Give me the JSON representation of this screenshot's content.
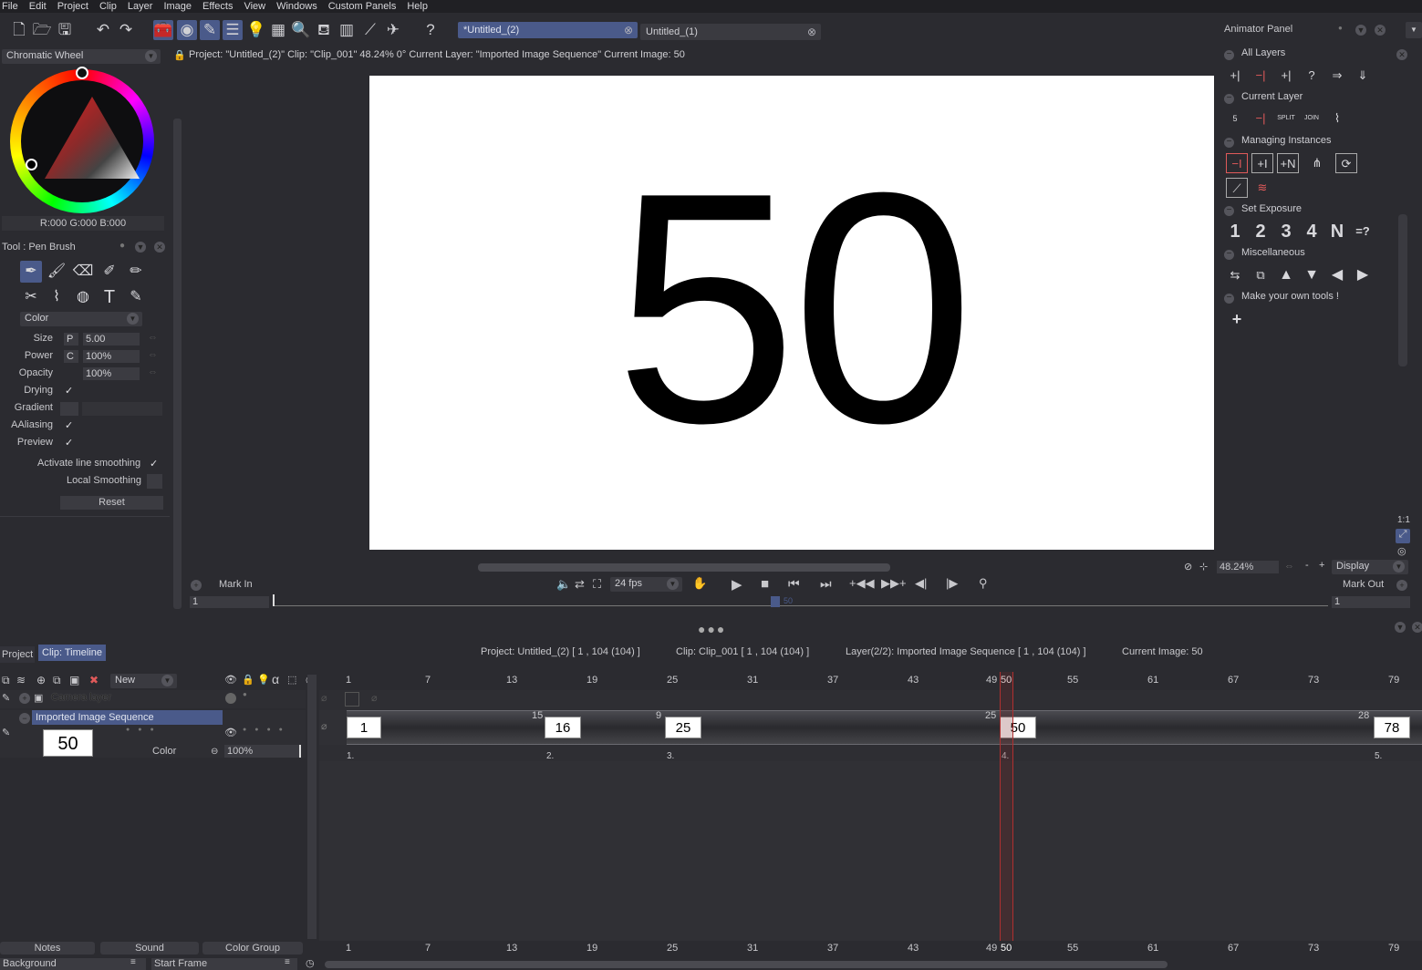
{
  "menu": [
    "File",
    "Edit",
    "Project",
    "Clip",
    "Layer",
    "Image",
    "Effects",
    "View",
    "Windows",
    "Custom Panels",
    "Help"
  ],
  "tabs": [
    {
      "label": "*Untitled_(2)",
      "active": true
    },
    {
      "label": "Untitled_(1)",
      "active": false
    }
  ],
  "info_bar": "Project:  \"Untitled_(2)\"  Clip: \"Clip_001\"   48.24%   0°  Current Layer: \"Imported Image Sequence\"  Current Image: 50",
  "color_panel": {
    "mode": "Chromatic Wheel",
    "rgb": "R:000 G:000 B:000"
  },
  "tool_panel": {
    "title": "Tool : Pen Brush",
    "color_mode": "Color",
    "size_label": "Size",
    "size_mode": "P",
    "size_value": "5.00",
    "power_label": "Power",
    "power_mode": "C",
    "power_value": "100%",
    "opacity_label": "Opacity",
    "opacity_value": "100%",
    "drying_label": "Drying",
    "gradient_label": "Gradient",
    "aaliasing_label": "AAliasing",
    "preview_label": "Preview",
    "line_smoothing_label": "Activate line smoothing",
    "local_smoothing_label": "Local Smoothing",
    "reset_label": "Reset"
  },
  "viewer": {
    "frame_number": "50",
    "zoom": "48.24%",
    "display": "Display",
    "fps": "24 fps",
    "mark_in_label": "Mark In",
    "mark_out_label": "Mark Out",
    "mark_in_value": "1",
    "mark_out_value": "1",
    "scrub_value": "50"
  },
  "animator": {
    "title": "Animator Panel",
    "sections": {
      "all_layers": "All Layers",
      "current_layer": "Current Layer",
      "managing_instances": "Managing Instances",
      "set_exposure": "Set Exposure",
      "misc": "Miscellaneous",
      "make_own": "Make your own tools !"
    },
    "exposure_buttons": [
      "1",
      "2",
      "3",
      "4",
      "N",
      "=?"
    ],
    "cl_labels": [
      "5",
      "",
      "SPLIT",
      "JOIN",
      ""
    ]
  },
  "timeline": {
    "tabs": [
      "Project",
      "Clip: Timeline"
    ],
    "project_info": "Project: Untitled_(2) [ 1 , 104  (104) ]",
    "clip_info": "Clip: Clip_001 [ 1 , 104  (104) ]",
    "layer_info": "Layer(2/2): Imported Image Sequence [ 1 , 104  (104) ]",
    "current_image": "Current Image: 50",
    "new_label": "New",
    "camera_layer": "Camera layer",
    "layer_name": "Imported Image Sequence",
    "layer_thumb": "50",
    "layer_mode": "Color",
    "layer_opacity": "100%",
    "ruler": [
      "1",
      "7",
      "13",
      "19",
      "25",
      "31",
      "37",
      "43",
      "49",
      "50",
      "55",
      "61",
      "67",
      "73",
      "79"
    ],
    "frames": [
      {
        "label": "1",
        "duration": "",
        "index": "1."
      },
      {
        "label": "16",
        "duration": "15",
        "index": "2."
      },
      {
        "label": "25",
        "duration": "9",
        "index": "3."
      },
      {
        "label": "50",
        "duration": "25",
        "index": "4."
      },
      {
        "label": "78",
        "duration": "28",
        "index": "5."
      }
    ],
    "bottom_buttons": [
      "Notes",
      "Sound",
      "Color Group"
    ],
    "background_label": "Background",
    "start_frame_label": "Start Frame"
  }
}
